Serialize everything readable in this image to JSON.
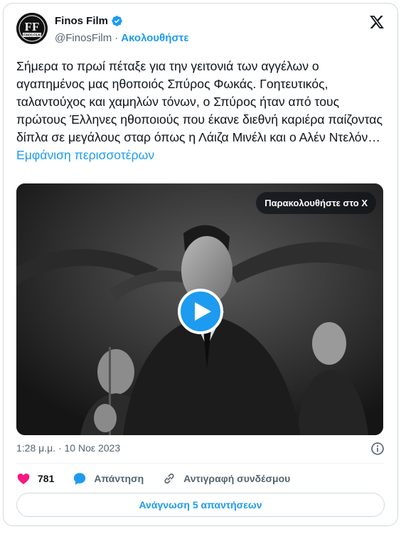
{
  "account": {
    "display_name": "Finos Film",
    "handle": "@FinosFilm",
    "separator": "·",
    "follow_label": "Ακολουθήστε",
    "avatar_text": "FF",
    "avatar_caption": "FINOS FILM"
  },
  "tweet": {
    "text": "Σήμερα το πρωί πέταξε για την γειτονιά των αγγέλων ο αγαπημένος μας ηθοποιός Σπύρος Φωκάς. Γοητευτικός, ταλαντούχος και χαμηλών τόνων, ο Σπύρος ήταν από τους πρώτους Έλληνες ηθοποιούς που έκανε διεθνή καριέρα παίζοντας δίπλα σε μεγάλους σταρ όπως η Λάιζα Μινέλι και ο Αλέν Ντελόν…",
    "show_more": "Εμφάνιση περισσοτέρων"
  },
  "media": {
    "watch_label": "Παρακολουθήστε στο X"
  },
  "meta": {
    "timestamp": "1:28 μ.μ. · 10 Νοε 2023"
  },
  "actions": {
    "likes": "781",
    "reply_label": "Απάντηση",
    "copy_link_label": "Αντιγραφή συνδέσμου"
  },
  "footer": {
    "read_replies_label": "Ανάγνωση 5 απαντήσεων"
  },
  "colors": {
    "accent": "#1d9bf0",
    "like": "#f91880",
    "muted": "#536471"
  },
  "icons": [
    "finos-film-logo",
    "verified-badge-icon",
    "x-logo-icon",
    "play-icon",
    "info-icon",
    "heart-icon",
    "reply-bubble-icon",
    "link-icon"
  ]
}
